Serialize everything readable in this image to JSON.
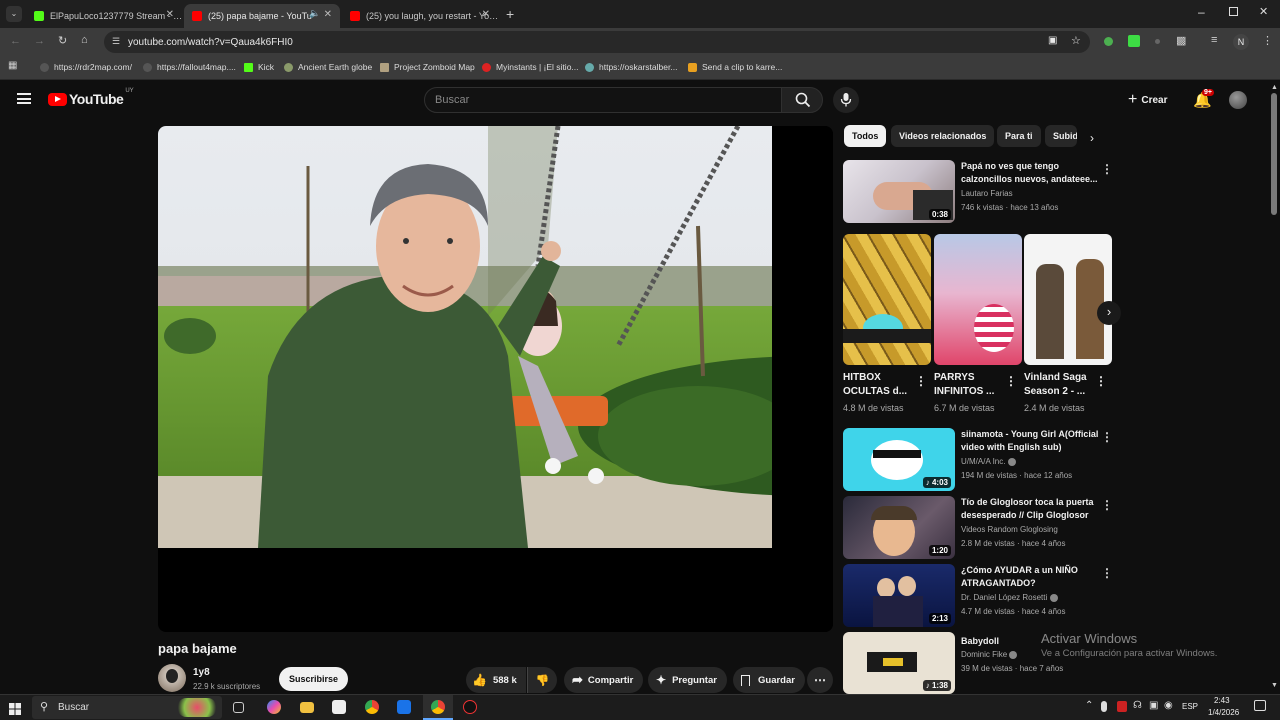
{
  "browser": {
    "tabs": [
      {
        "title": "ElPapuLoco1237779 Stream - …"
      },
      {
        "title": "(25) papa bajame - YouTub…"
      },
      {
        "title": "(25) you laugh, you restart - Yo…"
      }
    ],
    "url": "youtube.com/watch?v=Qaua4k6FHI0",
    "bookmarks": [
      {
        "label": "https://rdr2map.com/",
        "color": "#444"
      },
      {
        "label": "https://fallout4map....",
        "color": "#444"
      },
      {
        "label": "Kick",
        "color": "#53fc18"
      },
      {
        "label": "Ancient Earth globe",
        "color": "#8a9a6a"
      },
      {
        "label": "Project Zomboid Map",
        "color": "#b0a080"
      },
      {
        "label": "Myinstants | ¡El sitio...",
        "color": "#d22"
      },
      {
        "label": "https://oskarstalber...",
        "color": "#6aa"
      },
      {
        "label": "Send a clip to karre...",
        "color": "#e8a020"
      }
    ],
    "profile_initial": "N"
  },
  "youtube": {
    "logo": "YouTube",
    "region": "UY",
    "search_placeholder": "Buscar",
    "create_label": "Crear",
    "notif_count": "9+",
    "video": {
      "title": "papa bajame",
      "channel": "1y8",
      "subscribers": "22.9 k suscriptores",
      "subscribe_label": "Suscribirse",
      "likes": "588 k",
      "share_label": "Compartir",
      "ask_label": "Preguntar",
      "save_label": "Guardar"
    },
    "chips": [
      "Todos",
      "Videos relacionados",
      "Para ti",
      "Subid"
    ],
    "recommendations": [
      {
        "title": "Papá no ves que tengo calzoncillos nuevos, andateee...",
        "channel": "Lautaro Farias",
        "meta": "746 k vistas · hace 13 años",
        "duration": "0:38"
      },
      {
        "title": "siinamota - Young Girl A(Official video with English sub)",
        "channel": "U/M/A/A Inc.",
        "meta": "194 M de vistas · hace 12 años",
        "duration": "4:03"
      },
      {
        "title": "Tío de Gloglosor toca la puerta desesperado // Clip Gloglosor",
        "channel": "Videos Random Gloglosing",
        "meta": "2.8 M de vistas · hace 4 años",
        "duration": "1:20"
      },
      {
        "title": "¿Cómo AYUDAR a un NIÑO ATRAGANTADO?",
        "channel": "Dr. Daniel López Rosetti",
        "meta": "4.7 M de vistas · hace 4 años",
        "duration": "2:13"
      },
      {
        "title": "Babydoll",
        "channel": "Dominic Fike",
        "meta": "39 M de vistas · hace 7 años",
        "duration": "1:38"
      }
    ],
    "shorts": [
      {
        "title": "HITBOX OCULTAS d...",
        "views": "4.8 M de vistas"
      },
      {
        "title": "PARRYS INFINITOS ...",
        "views": "6.7 M de vistas"
      },
      {
        "title": "Vinland Saga Season 2 - ...",
        "views": "2.4 M de vistas"
      }
    ]
  },
  "watermark": {
    "line1": "Activar Windows",
    "line2": "Ve a Configuración para activar Windows."
  },
  "taskbar": {
    "search_placeholder": "Buscar",
    "lang": "ESP",
    "time": "2:43",
    "date": "1/4/2026"
  }
}
